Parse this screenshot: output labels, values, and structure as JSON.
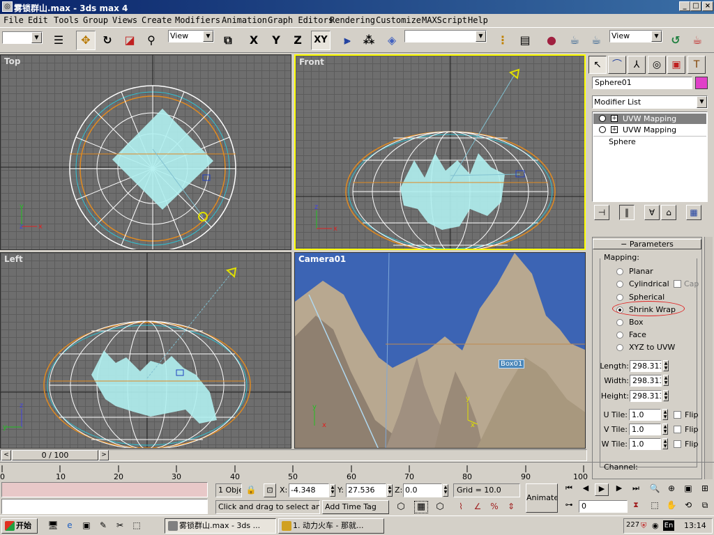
{
  "window": {
    "title": "雾锁群山.max - 3ds max 4",
    "minimize": "_",
    "maximize": "□",
    "close": "×"
  },
  "menu": [
    "File",
    "Edit",
    "Tools",
    "Group",
    "Views",
    "Create",
    "Modifiers",
    "Animation",
    "Graph Editors",
    "Rendering",
    "Customize",
    "MAXScript",
    "Help"
  ],
  "toolbar": {
    "selection_filter": "",
    "coord_system": "View",
    "axis_x": "X",
    "axis_y": "Y",
    "axis_z": "Z",
    "axis_xy": "XY",
    "named_selection": "",
    "render_view": "View"
  },
  "viewports": {
    "top": "Top",
    "front": "Front",
    "left": "Left",
    "camera": "Camera01",
    "camera_tag": "Box01"
  },
  "command_panel": {
    "object_name": "Sphere01",
    "object_color": "#e040c8",
    "modifier_list": "Modifier List",
    "stack": [
      "UVW Mapping",
      "UVW Mapping",
      "Sphere"
    ],
    "rollout_title": "Parameters",
    "mapping_label": "Mapping:",
    "mapping_options": [
      "Planar",
      "Cylindrical",
      "Spherical",
      "Shrink Wrap",
      "Box",
      "Face",
      "XYZ to UVW"
    ],
    "selected_mapping": "Shrink Wrap",
    "cap_label": "Cap",
    "length_label": "Length:",
    "length": "298.313",
    "width_label": "Width:",
    "width": "298.313",
    "height_label": "Height:",
    "height": "298.313",
    "utile_label": "U Tile:",
    "utile": "1.0",
    "vtile_label": "V Tile:",
    "vtile": "1.0",
    "wtile_label": "W Tile:",
    "wtile": "1.0",
    "flip_label": "Flip",
    "channel_label": "Channel:"
  },
  "timeline": {
    "frame": "0 / 100",
    "ticks": [
      "0",
      "10",
      "20",
      "30",
      "40",
      "50",
      "60",
      "70",
      "80",
      "90",
      "100"
    ]
  },
  "status": {
    "selected": "1 Obje",
    "x_label": "X:",
    "x": "-4.348",
    "y_label": "Y:",
    "y": "27.536",
    "z_label": "Z:",
    "z": "0.0",
    "grid": "Grid = 10.0",
    "prompt": "Click and drag to select and r",
    "add_time_tag": "Add Time Tag",
    "animate": "Animate",
    "current_frame": "0"
  },
  "taskbar": {
    "start": "开始",
    "tasks": [
      "雾锁群山.max - 3ds ...",
      "1. 动力火车 - 那就..."
    ],
    "tray_num": "227",
    "tray_lang": "En",
    "clock": "13:14"
  }
}
